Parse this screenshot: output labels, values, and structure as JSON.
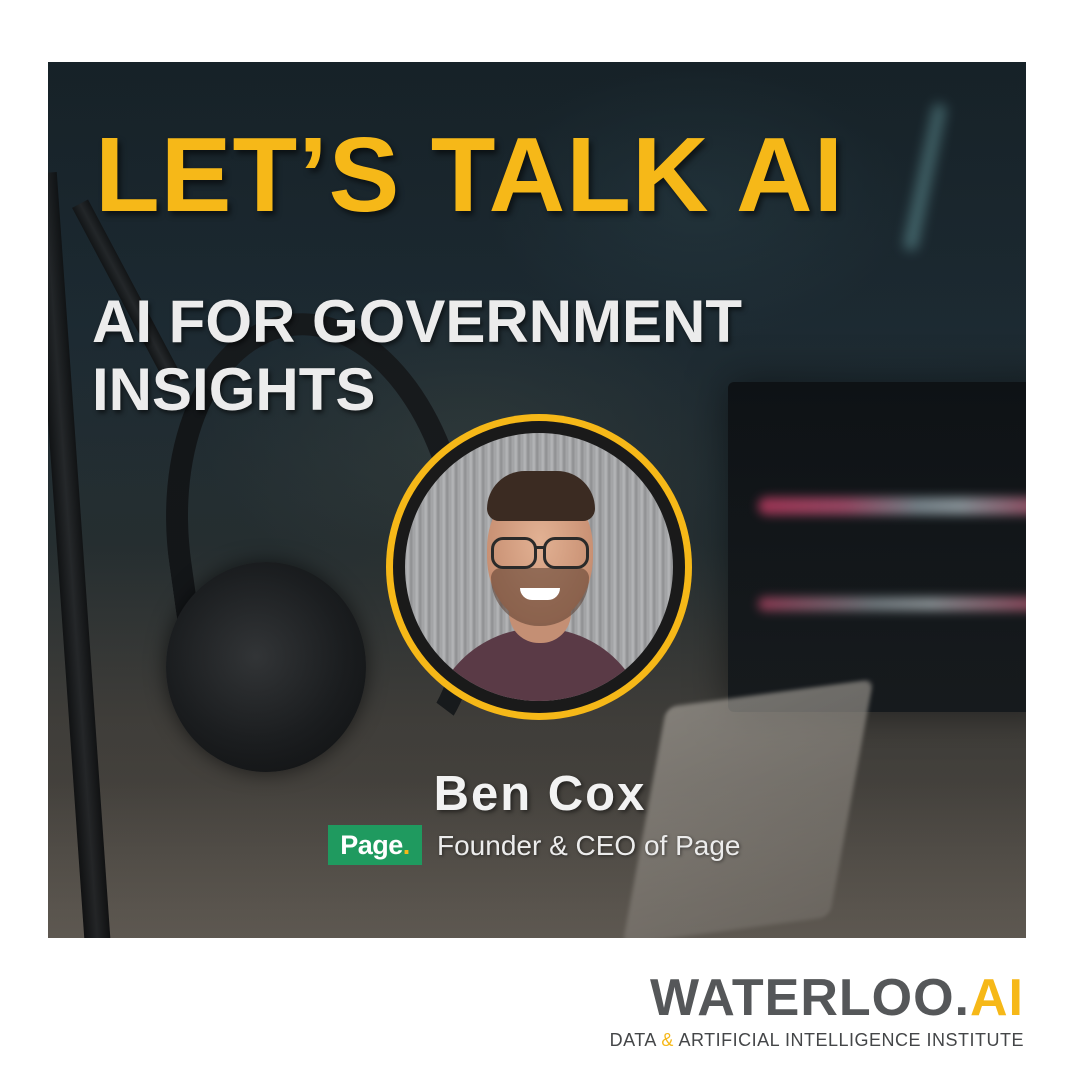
{
  "headline": "LET’S TALK AI",
  "subheadline_line1": "AI FOR GOVERNMENT",
  "subheadline_line2": "INSIGHTS",
  "speaker": {
    "name": "Ben Cox",
    "company_logo_text": "Page",
    "company_logo_dot": ".",
    "role": "Founder & CEO of Page"
  },
  "brand": {
    "name_part1": "WATERLOO.",
    "name_part2": "AI",
    "tagline_part1": "DATA ",
    "tagline_amp": "&",
    "tagline_part2": " ARTIFICIAL INTELLIGENCE INSTITUTE"
  },
  "colors": {
    "accent": "#f6b818",
    "page_logo_green": "#1f9a5f",
    "brand_gray": "#555759"
  }
}
